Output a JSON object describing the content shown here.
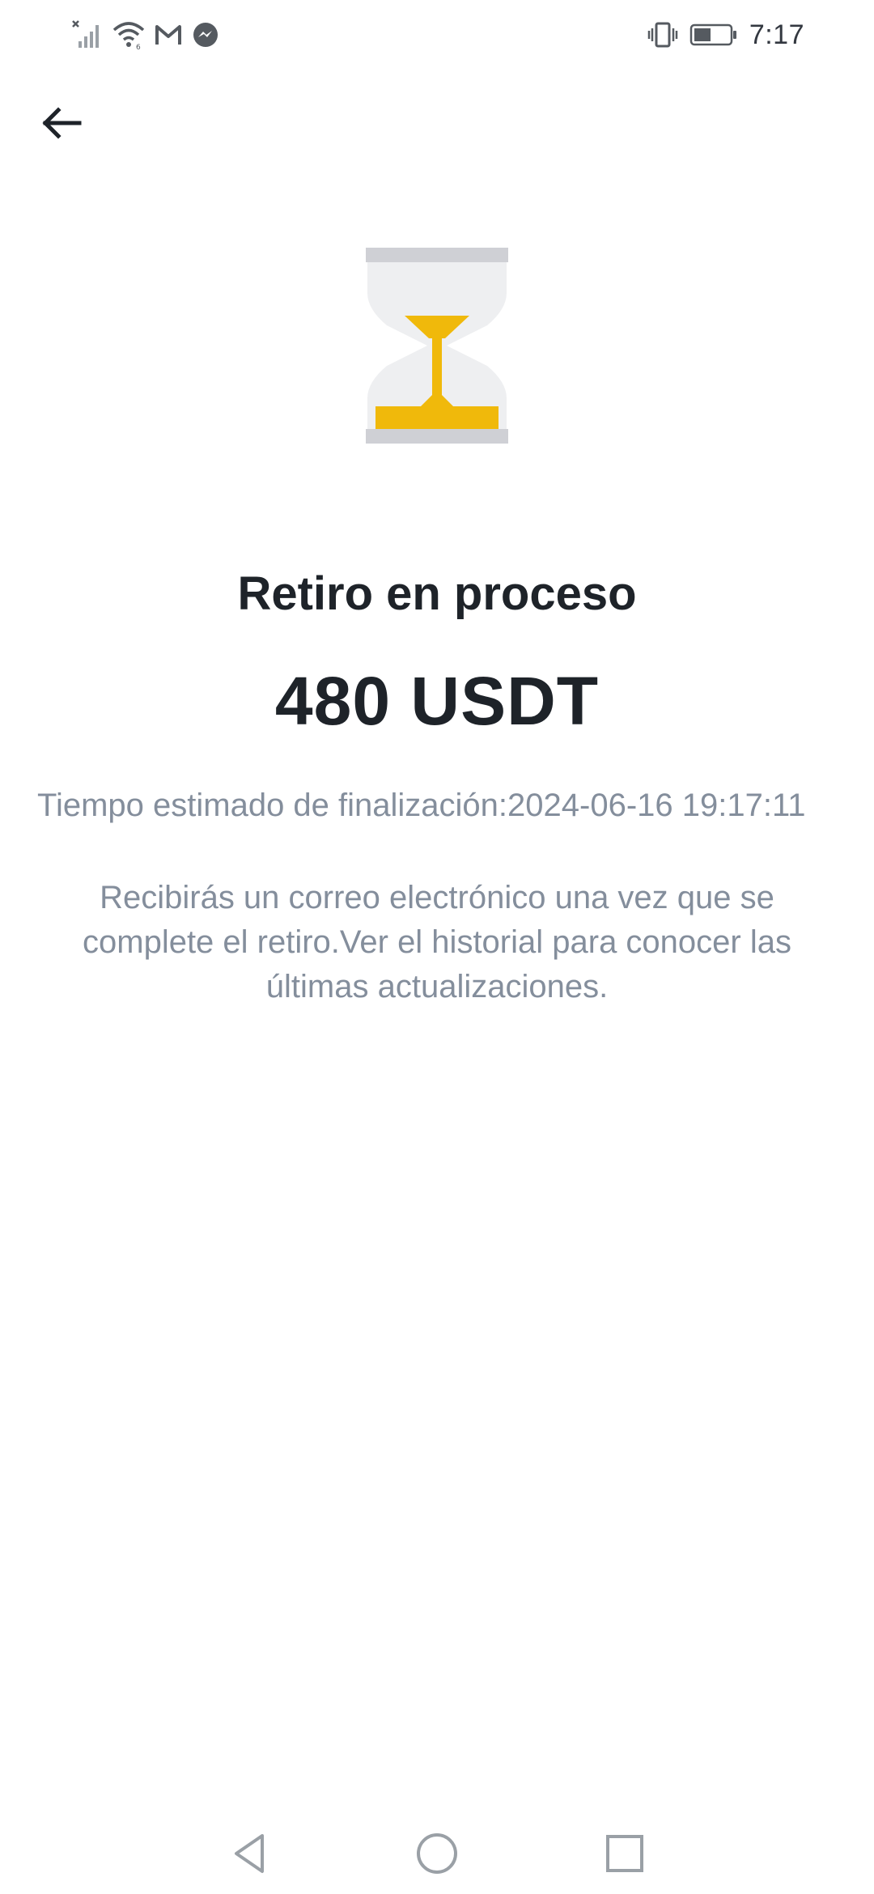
{
  "status_bar": {
    "time": "7:17",
    "icons": [
      "no-signal-icon",
      "wifi-icon",
      "gmail-icon",
      "messenger-icon",
      "vibrate-icon",
      "battery-icon"
    ]
  },
  "header": {
    "back_icon": "arrow-left-icon"
  },
  "illustration": {
    "icon": "hourglass-icon",
    "colors": {
      "sand": "#f0b90b",
      "glass": "#eeeff1",
      "caps": "#cfd0d5"
    }
  },
  "main": {
    "title": "Retiro en proceso",
    "amount": "480 USDT",
    "estimated_label": "Tiempo estimado de finalización:2024-06-16 19:17:11",
    "info_text": "Recibirás un correo electrónico una vez que se complete el retiro.Ver el historial para conocer las últimas actualizaciones."
  },
  "nav_bar": {
    "icons": [
      "nav-back-icon",
      "nav-home-icon",
      "nav-recents-icon"
    ]
  }
}
